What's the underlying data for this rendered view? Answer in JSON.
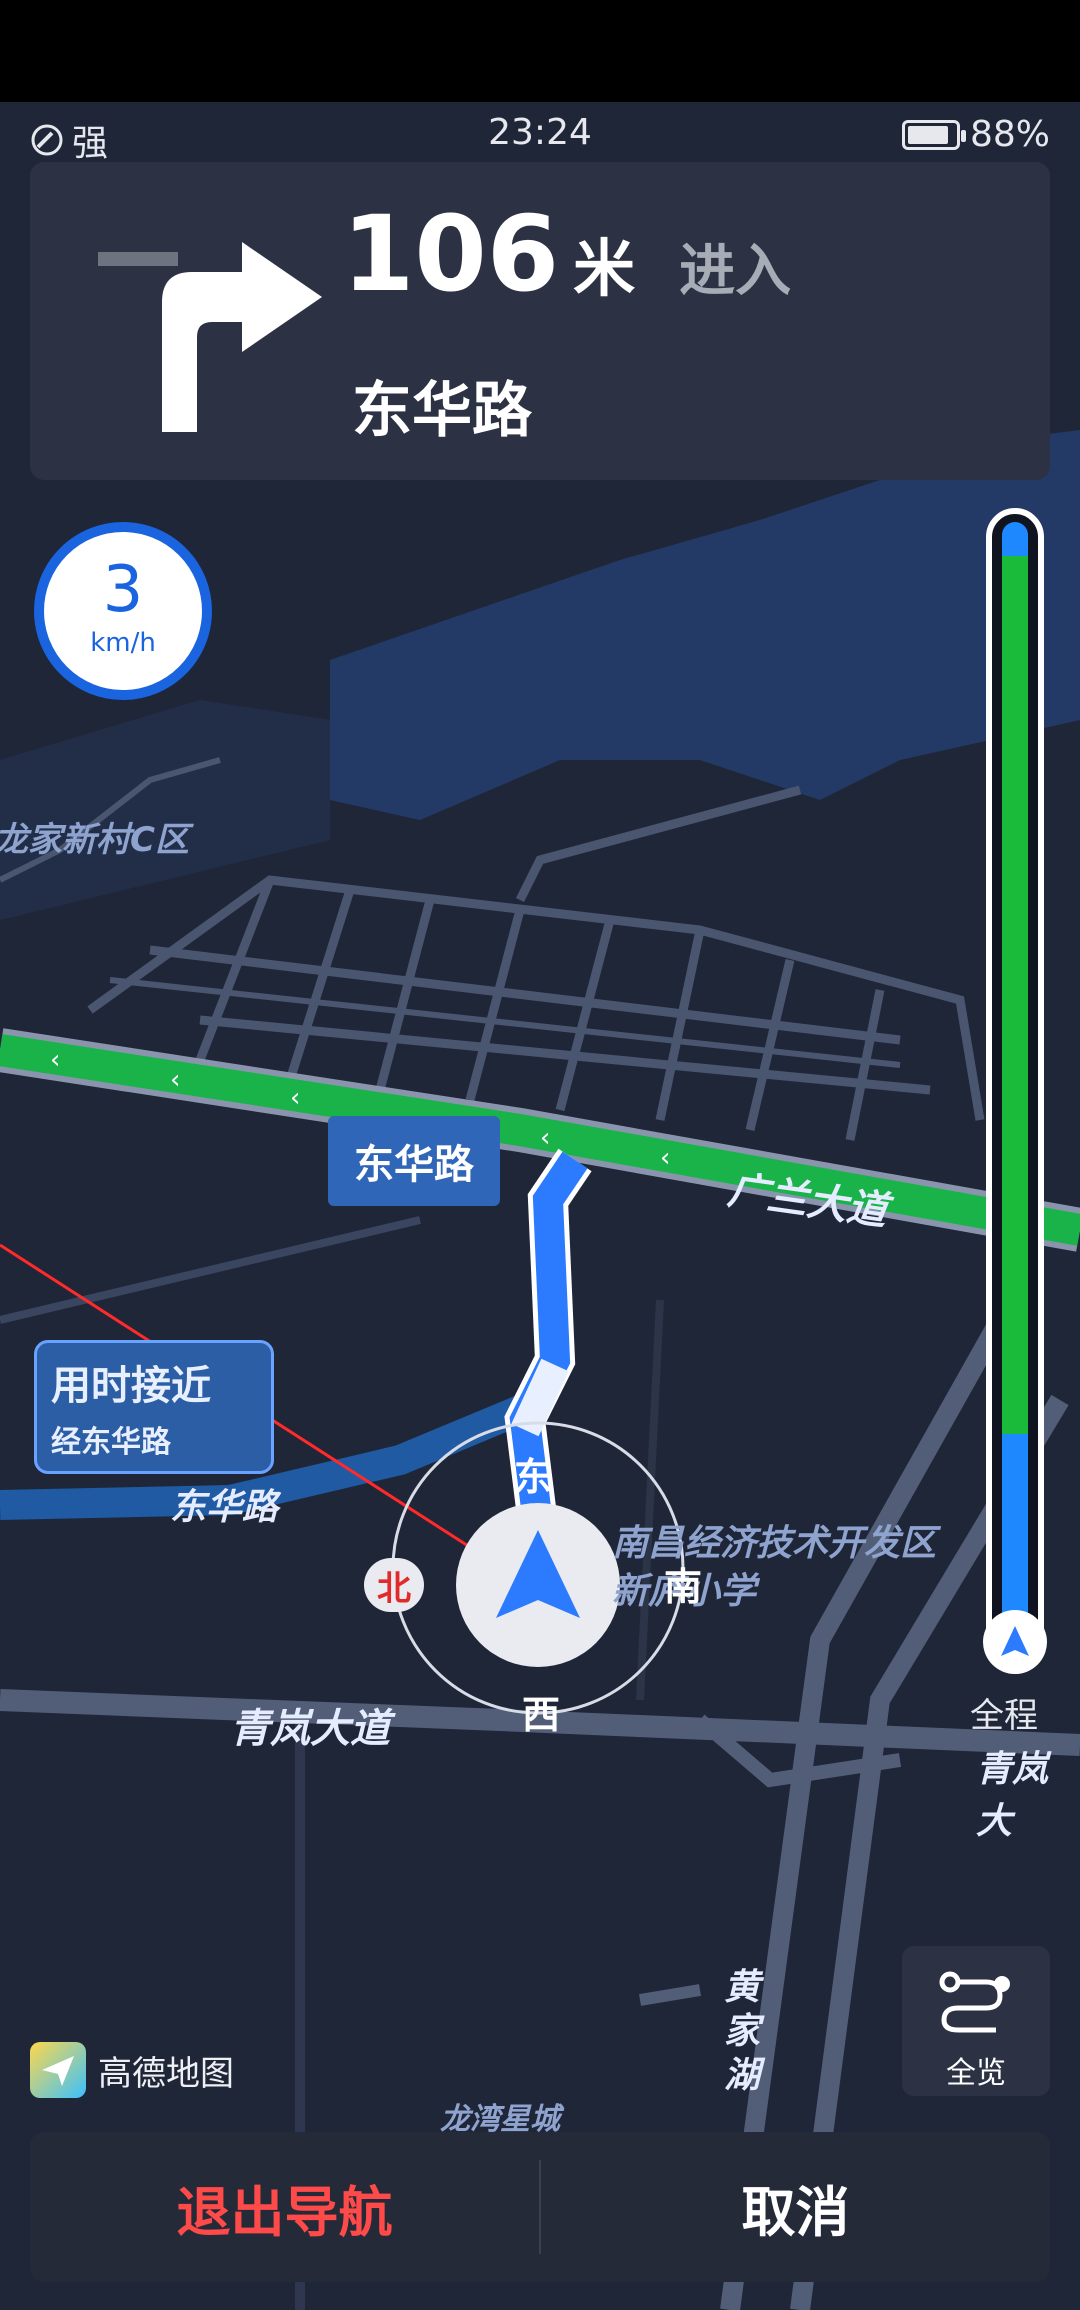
{
  "status": {
    "signal_label": "强",
    "time": "23:24",
    "battery_percent": "88%",
    "battery_level": 0.88
  },
  "guidance": {
    "distance_value": "106",
    "distance_unit": "米",
    "action_text": "进入",
    "road_name": "东华路",
    "turn_direction": "right",
    "icon": "turn-right-arrow-icon"
  },
  "speed": {
    "value": "3",
    "unit": "km/h"
  },
  "progress": {
    "label": "全程",
    "completed_fraction": 0.05,
    "traffic_colors": {
      "smooth": "#1aba3a",
      "unknown": "#1e88ff"
    }
  },
  "map": {
    "route_label": "东华路",
    "eta_bubble_line1": "用时接近",
    "eta_bubble_line2": "经东华路",
    "labels": [
      "龙家新村C区",
      "广兰大道",
      "东华路",
      "南昌经济技术开发区新庐小学",
      "青岚大道",
      "青岚大",
      "黄家湖",
      "龙湾星城"
    ],
    "compass": {
      "north": "北",
      "east": "东",
      "south": "南",
      "west": "西"
    },
    "colors": {
      "route_blue": "#2c7bff",
      "road_green": "#19b34a",
      "background": "#1f2638"
    }
  },
  "controls": {
    "overview_label": "全览",
    "exit_navigation": "退出导航",
    "cancel": "取消"
  },
  "brand": {
    "name": "高德地图"
  }
}
